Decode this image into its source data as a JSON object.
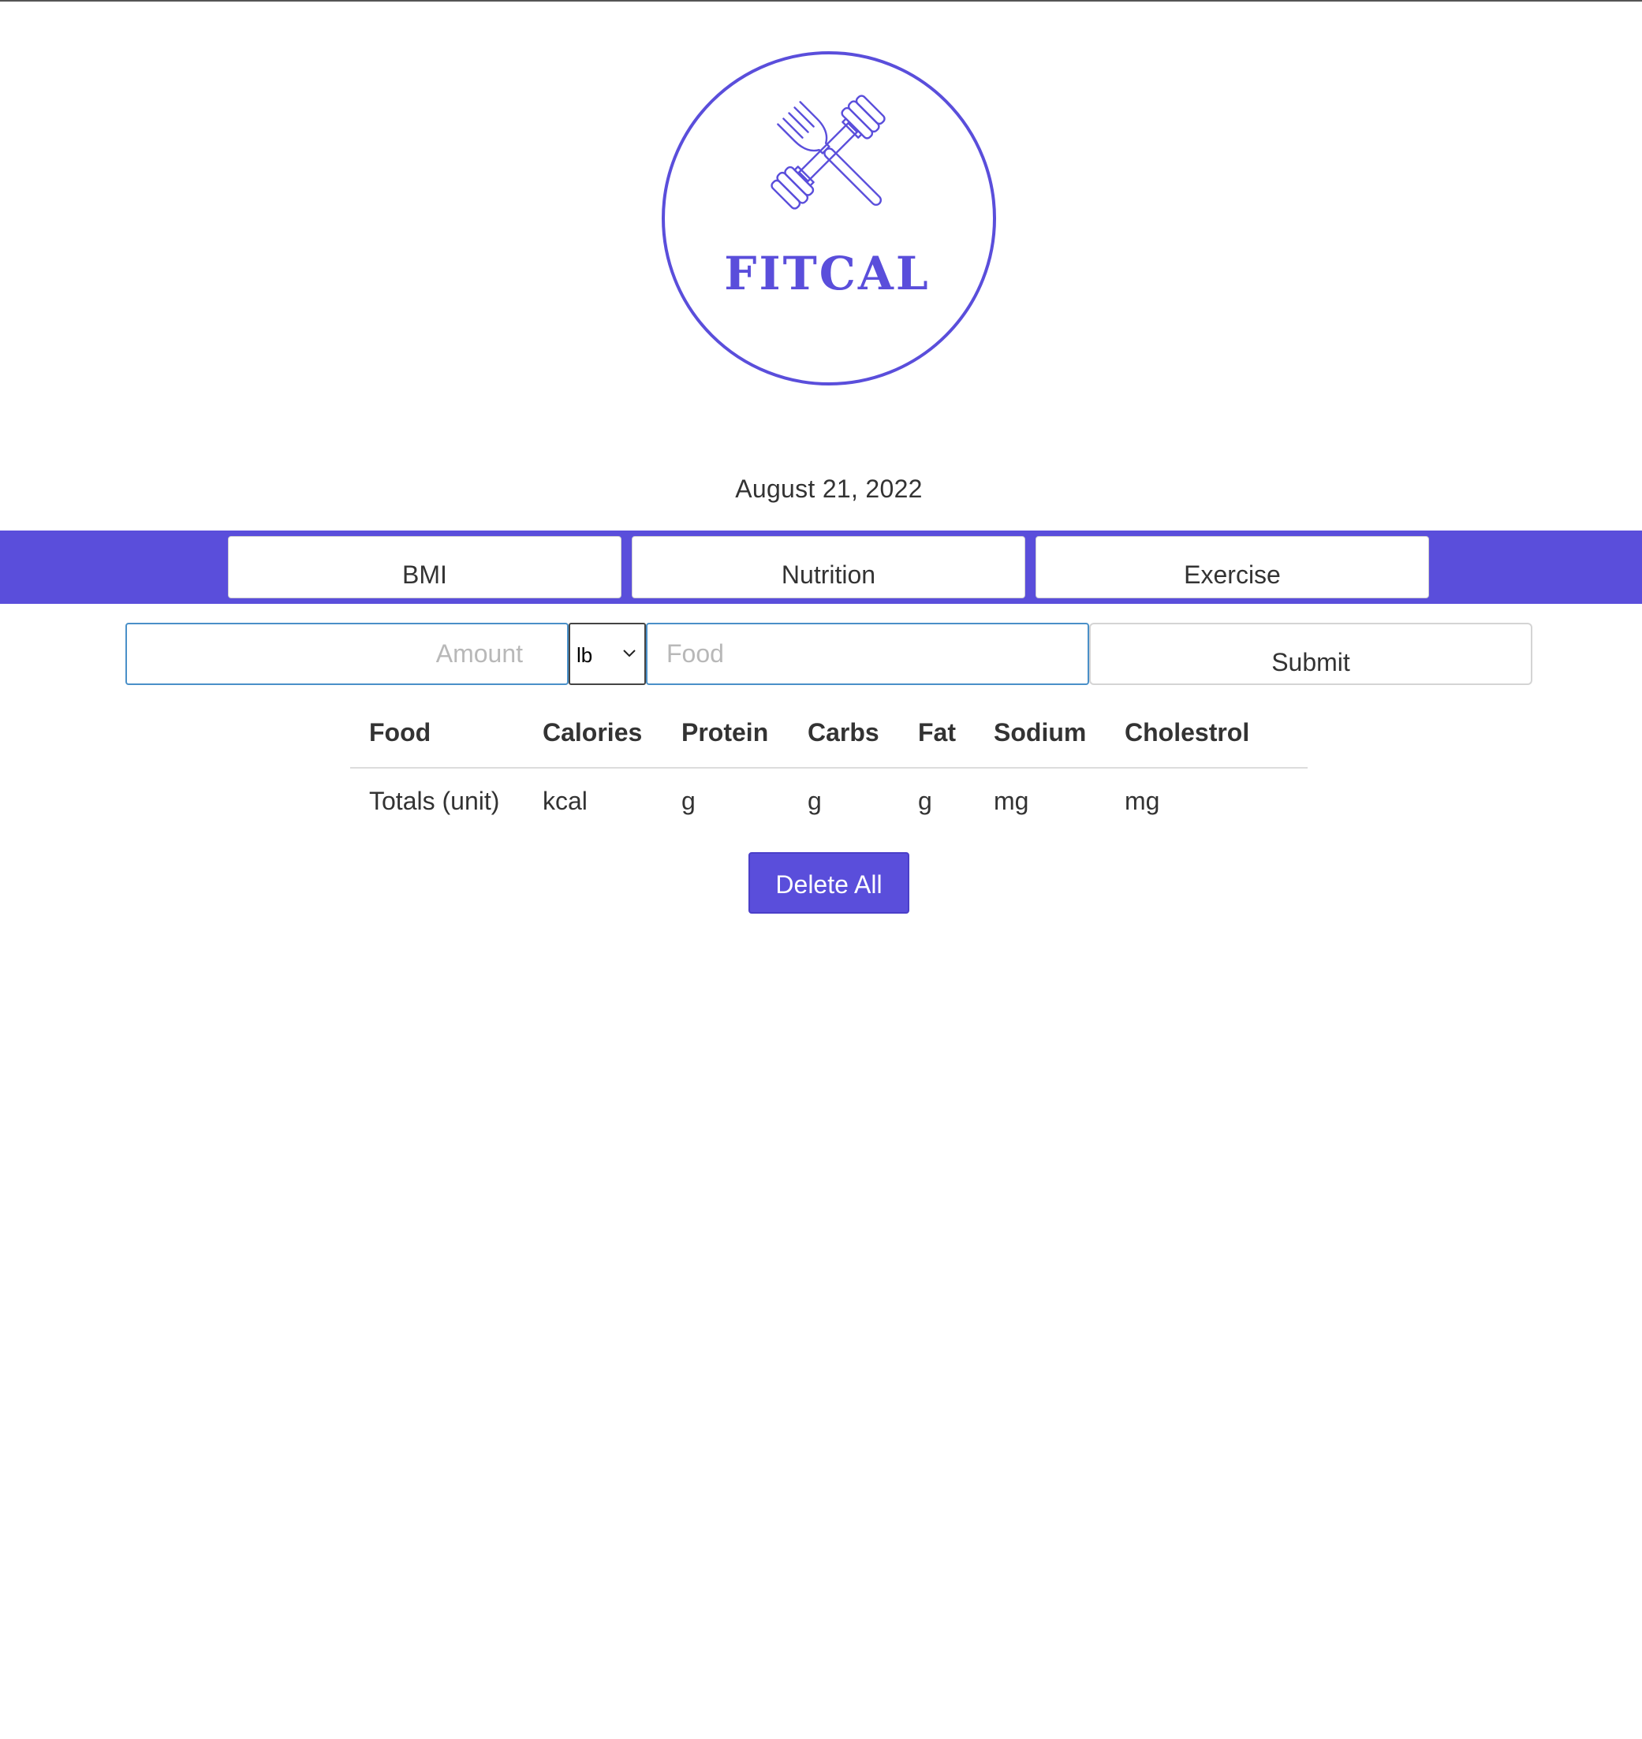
{
  "brand": {
    "name": "FITCAL",
    "accent_color": "#5a4edb",
    "logo_icon": "fork-and-dumbbell-icon"
  },
  "date": "August 21, 2022",
  "nav": {
    "bmi_label": "BMI",
    "nutrition_label": "Nutrition",
    "exercise_label": "Exercise"
  },
  "form": {
    "amount_placeholder": "Amount",
    "unit_selected": "lb",
    "food_placeholder": "Food",
    "submit_label": "Submit"
  },
  "table": {
    "headers": [
      "Food",
      "Calories",
      "Protein",
      "Carbs",
      "Fat",
      "Sodium",
      "Cholestrol"
    ],
    "totals_row": [
      "Totals (unit)",
      "kcal",
      "g",
      "g",
      "g",
      "mg",
      "mg"
    ]
  },
  "delete_all_label": "Delete All"
}
